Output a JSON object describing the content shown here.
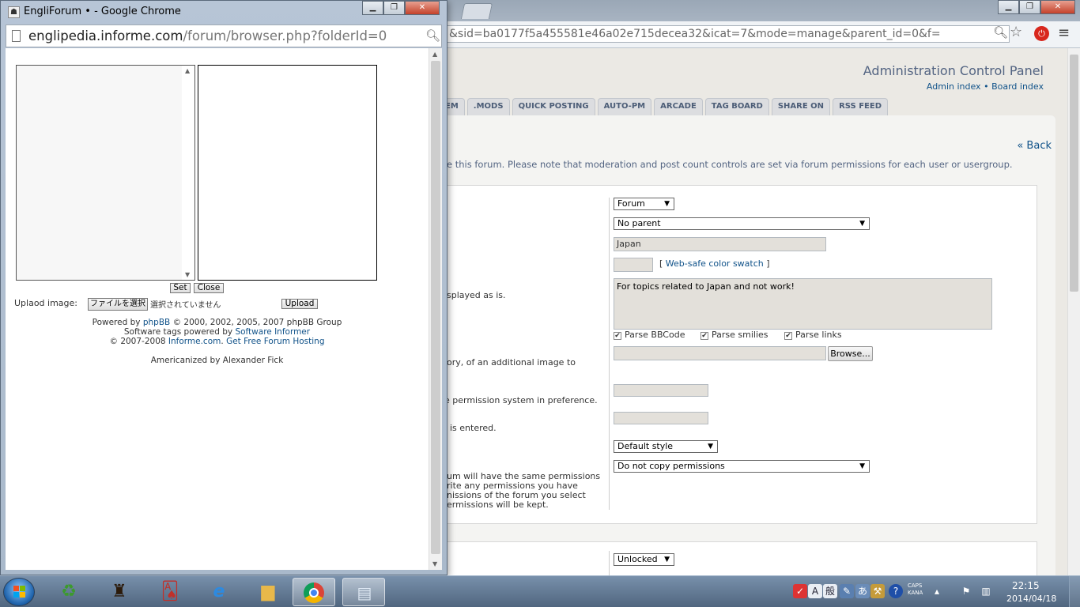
{
  "background_window": {
    "url": "&sid=ba0177f5a455581e46a02e715decea32&icat=7&mode=manage&parent_id=0&f=",
    "acp_title": "Administration Control Panel",
    "acp_links": {
      "admin_index": "Admin index",
      "separator": "•",
      "board_index": "Board index"
    },
    "tabs": [
      "EM",
      ".MODS",
      "QUICK POSTING",
      "AUTO-PM",
      "ARCADE",
      "TAG BOARD",
      "SHARE ON",
      "RSS FEED"
    ],
    "back_link": "« Back",
    "intro_text": "e this forum. Please note that moderation and post count controls are set via forum permissions for each user or usergroup.",
    "form": {
      "forum_type": "Forum",
      "parent": "No parent",
      "forum_name": "Japan",
      "swatch_bracket_open": "[",
      "swatch_link": "Web-safe color swatch",
      "swatch_bracket_close": "]",
      "description": "For topics related to Japan and not work!",
      "description_help": "splayed as is.",
      "parse_bbcode": "Parse BBCode",
      "parse_smilies": "Parse smilies",
      "parse_links": "Parse links",
      "image_help": "ory, of an additional image to",
      "browse_button": "Browse...",
      "password_help": "e permission system in preference.",
      "password_confirm_help": "is entered.",
      "style": "Default style",
      "copy_permissions": "Do not copy permissions",
      "copy_help_1": "um will have the same permissions",
      "copy_help_2": "rite any permissions you have",
      "copy_help_3": "nissions of the forum you select",
      "copy_help_4": "ermissions will be kept.",
      "status": "Unlocked"
    }
  },
  "popup": {
    "window_title": "EngliForum • - Google Chrome",
    "url_domain": "englipedia.informe.com",
    "url_path": "/forum/browser.php?folderId=0",
    "set_button": "Set",
    "close_button": "Close",
    "upload_label": "Uplaod image:",
    "choose_file_button": "ファイルを選択",
    "file_status": "選択されていません",
    "upload_button": "Upload",
    "credits": {
      "line1_pre": "Powered by ",
      "line1_link": "phpBB",
      "line1_post": " © 2000, 2002, 2005, 2007 phpBB Group",
      "line2_pre": "Software tags powered by ",
      "line2_link": "Software Informer",
      "line3_pre": "© 2007-2008 ",
      "line3_link1": "Informe.com",
      "line3_mid": ". ",
      "line3_link2": "Get Free Forum Hosting",
      "line4": "Americanized by Alexander Fick"
    }
  },
  "taskbar": {
    "ime_mode": "A",
    "ime_label": "般",
    "caps": "CAPS",
    "kana": "KANA",
    "time": "22:15",
    "date": "2014/04/18"
  }
}
